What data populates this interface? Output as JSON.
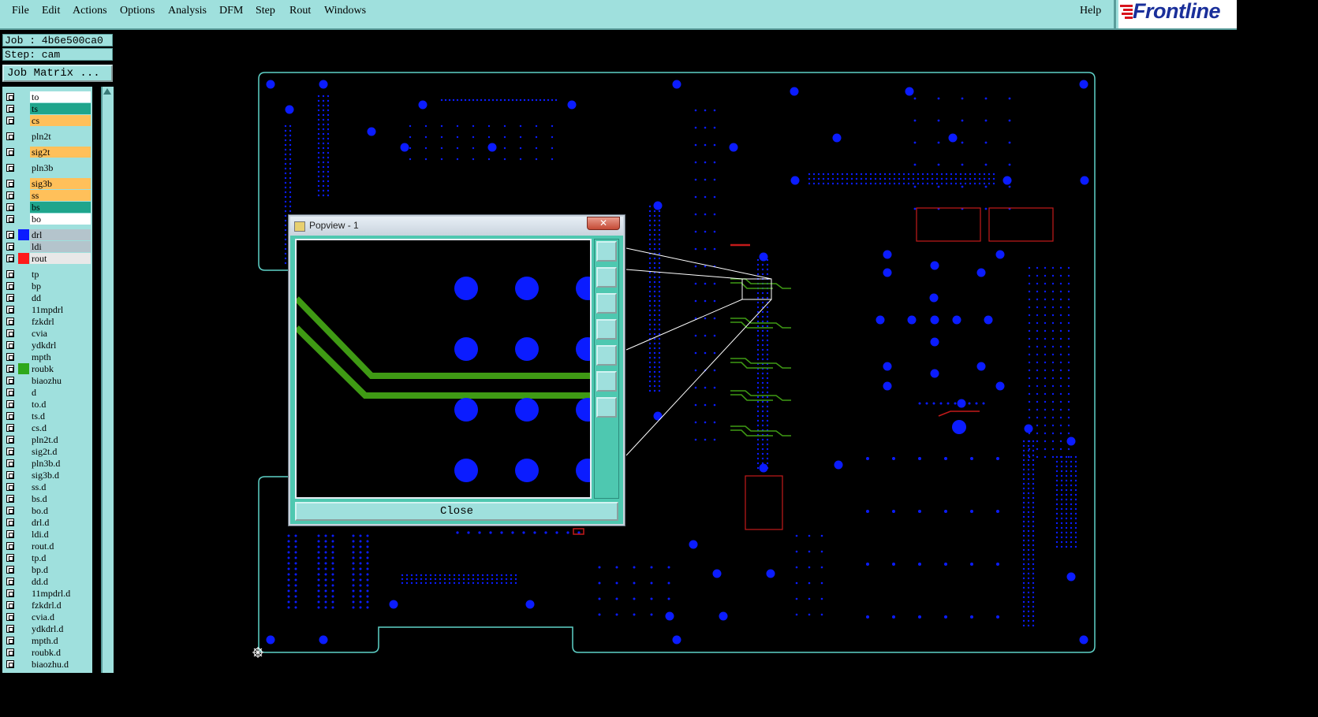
{
  "menu": {
    "items": [
      "File",
      "Edit",
      "Actions",
      "Options",
      "Analysis",
      "DFM",
      "Step",
      "Rout",
      "Windows"
    ],
    "help": "Help",
    "logo": "Frontline"
  },
  "job": {
    "label": "Job : 4b6e500ca0",
    "step": "Step: cam",
    "matrix_button": "Job Matrix ..."
  },
  "layers": [
    {
      "name": "to",
      "color": "#ffffff",
      "swatch": ""
    },
    {
      "name": "ts",
      "color": "#1fa58c",
      "swatch": ""
    },
    {
      "name": "cs",
      "color": "#ffc05a",
      "swatch": ""
    },
    {
      "name": "pln2t",
      "color": "#9fe0dd",
      "swatch": ""
    },
    {
      "name": "sig2t",
      "color": "#ffc05a",
      "swatch": ""
    },
    {
      "name": "pln3b",
      "color": "#9fe0dd",
      "swatch": ""
    },
    {
      "name": "sig3b",
      "color": "#ffc05a",
      "swatch": ""
    },
    {
      "name": "ss",
      "color": "#ffc05a",
      "swatch": ""
    },
    {
      "name": "bs",
      "color": "#1fa58c",
      "swatch": ""
    },
    {
      "name": "bo",
      "color": "#ffffff",
      "swatch": ""
    },
    {
      "name": "drl",
      "color": "#b4c4cc",
      "swatch": "#0b1cff"
    },
    {
      "name": "ldi",
      "color": "#b4c4cc",
      "swatch": ""
    },
    {
      "name": "rout",
      "color": "#e8e8e8",
      "swatch": "#ff1a1a"
    },
    {
      "name": "tp",
      "color": "#9fe0dd",
      "swatch": ""
    },
    {
      "name": "bp",
      "color": "#9fe0dd",
      "swatch": ""
    },
    {
      "name": "dd",
      "color": "#9fe0dd",
      "swatch": ""
    },
    {
      "name": "11mpdrl",
      "color": "#9fe0dd",
      "swatch": ""
    },
    {
      "name": "fzkdrl",
      "color": "#9fe0dd",
      "swatch": ""
    },
    {
      "name": "cvia",
      "color": "#9fe0dd",
      "swatch": ""
    },
    {
      "name": "ydkdrl",
      "color": "#9fe0dd",
      "swatch": ""
    },
    {
      "name": "mpth",
      "color": "#9fe0dd",
      "swatch": ""
    },
    {
      "name": "roubk",
      "color": "#9fe0dd",
      "swatch": "#2ea81a"
    },
    {
      "name": "biaozhu",
      "color": "#9fe0dd",
      "swatch": ""
    },
    {
      "name": "d",
      "color": "#9fe0dd",
      "swatch": ""
    },
    {
      "name": "to.d",
      "color": "#9fe0dd",
      "swatch": ""
    },
    {
      "name": "ts.d",
      "color": "#9fe0dd",
      "swatch": ""
    },
    {
      "name": "cs.d",
      "color": "#9fe0dd",
      "swatch": ""
    },
    {
      "name": "pln2t.d",
      "color": "#9fe0dd",
      "swatch": ""
    },
    {
      "name": "sig2t.d",
      "color": "#9fe0dd",
      "swatch": ""
    },
    {
      "name": "pln3b.d",
      "color": "#9fe0dd",
      "swatch": ""
    },
    {
      "name": "sig3b.d",
      "color": "#9fe0dd",
      "swatch": ""
    },
    {
      "name": "ss.d",
      "color": "#9fe0dd",
      "swatch": ""
    },
    {
      "name": "bs.d",
      "color": "#9fe0dd",
      "swatch": ""
    },
    {
      "name": "bo.d",
      "color": "#9fe0dd",
      "swatch": ""
    },
    {
      "name": "drl.d",
      "color": "#9fe0dd",
      "swatch": ""
    },
    {
      "name": "ldi.d",
      "color": "#9fe0dd",
      "swatch": ""
    },
    {
      "name": "rout.d",
      "color": "#9fe0dd",
      "swatch": ""
    },
    {
      "name": "tp.d",
      "color": "#9fe0dd",
      "swatch": ""
    },
    {
      "name": "bp.d",
      "color": "#9fe0dd",
      "swatch": ""
    },
    {
      "name": "dd.d",
      "color": "#9fe0dd",
      "swatch": ""
    },
    {
      "name": "11mpdrl.d",
      "color": "#9fe0dd",
      "swatch": ""
    },
    {
      "name": "fzkdrl.d",
      "color": "#9fe0dd",
      "swatch": ""
    },
    {
      "name": "cvia.d",
      "color": "#9fe0dd",
      "swatch": ""
    },
    {
      "name": "ydkdrl.d",
      "color": "#9fe0dd",
      "swatch": ""
    },
    {
      "name": "mpth.d",
      "color": "#9fe0dd",
      "swatch": ""
    },
    {
      "name": "roubk.d",
      "color": "#9fe0dd",
      "swatch": ""
    },
    {
      "name": "biaozhu.d",
      "color": "#9fe0dd",
      "swatch": ""
    }
  ],
  "popview": {
    "title": "Popview - 1",
    "close_x": "✕",
    "close_label": "Close",
    "tools": [
      "zoom-fit-icon",
      "zoom-in-icon",
      "zoom-out-icon",
      "pan-left-icon",
      "pan-right-icon",
      "expand-icon",
      "center-icon"
    ]
  },
  "colors": {
    "panel": "#9fe0dd",
    "pad": "#0b1cff",
    "outline": "#5fd2c8",
    "trace": "#3f9a14",
    "rout": "#c41a1a"
  }
}
